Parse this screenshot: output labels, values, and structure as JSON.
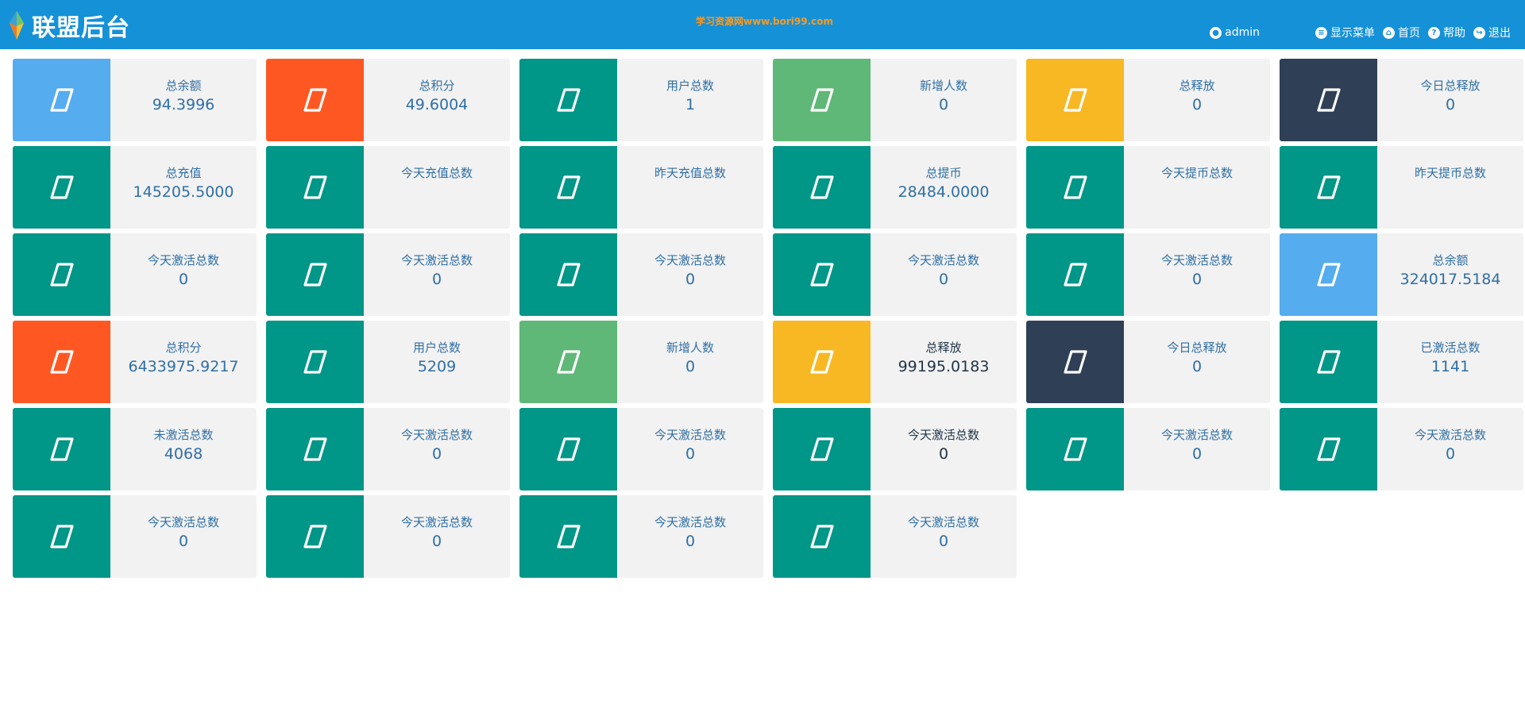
{
  "header": {
    "title": "联盟后台",
    "watermark": "学习资源网www.bori99.com",
    "user": "admin",
    "nav": [
      {
        "label": "显示菜单",
        "icon": "list-icon"
      },
      {
        "label": "首页",
        "icon": "home-icon"
      },
      {
        "label": "帮助",
        "icon": "help-icon"
      },
      {
        "label": "退出",
        "icon": "logout-icon"
      }
    ]
  },
  "colors": {
    "header": "#1591d8",
    "blue": "#55acee",
    "orange": "#ff5722",
    "teal": "#009688",
    "green": "#5fb878",
    "yellow": "#f7b824",
    "navy": "#2f4056",
    "card_bg": "#f2f2f2",
    "label_text": "#2f6fa5"
  },
  "cards": [
    {
      "label": "总余额",
      "value": "94.3996",
      "color": "blue"
    },
    {
      "label": "总积分",
      "value": "49.6004",
      "color": "orange"
    },
    {
      "label": "用户总数",
      "value": "1",
      "color": "teal"
    },
    {
      "label": "新增人数",
      "value": "0",
      "color": "green"
    },
    {
      "label": "总释放",
      "value": "0",
      "color": "yellow"
    },
    {
      "label": "今日总释放",
      "value": "0",
      "color": "navy"
    },
    {
      "label": "总充值",
      "value": "145205.5000",
      "color": "teal"
    },
    {
      "label": "今天充值总数",
      "value": "",
      "color": "teal"
    },
    {
      "label": "昨天充值总数",
      "value": "",
      "color": "teal"
    },
    {
      "label": "总提币",
      "value": "28484.0000",
      "color": "teal"
    },
    {
      "label": "今天提币总数",
      "value": "",
      "color": "teal"
    },
    {
      "label": "昨天提币总数",
      "value": "",
      "color": "teal"
    },
    {
      "label": "今天激活总数",
      "value": "0",
      "color": "teal"
    },
    {
      "label": "今天激活总数",
      "value": "0",
      "color": "teal"
    },
    {
      "label": "今天激活总数",
      "value": "0",
      "color": "teal"
    },
    {
      "label": "今天激活总数",
      "value": "0",
      "color": "teal"
    },
    {
      "label": "今天激活总数",
      "value": "0",
      "color": "teal"
    },
    {
      "label": "总余额",
      "value": "324017.5184",
      "color": "blue"
    },
    {
      "label": "总积分",
      "value": "6433975.9217",
      "color": "orange"
    },
    {
      "label": "用户总数",
      "value": "5209",
      "color": "teal"
    },
    {
      "label": "新增人数",
      "value": "0",
      "color": "green"
    },
    {
      "label": "总释放",
      "value": "99195.0183",
      "color": "yellow",
      "dark": true
    },
    {
      "label": "今日总释放",
      "value": "0",
      "color": "navy"
    },
    {
      "label": "已激活总数",
      "value": "1141",
      "color": "teal"
    },
    {
      "label": "未激活总数",
      "value": "4068",
      "color": "teal"
    },
    {
      "label": "今天激活总数",
      "value": "0",
      "color": "teal"
    },
    {
      "label": "今天激活总数",
      "value": "0",
      "color": "teal"
    },
    {
      "label": "今天激活总数",
      "value": "0",
      "color": "teal",
      "dark": true
    },
    {
      "label": "今天激活总数",
      "value": "0",
      "color": "teal"
    },
    {
      "label": "今天激活总数",
      "value": "0",
      "color": "teal"
    },
    {
      "label": "今天激活总数",
      "value": "0",
      "color": "teal"
    },
    {
      "label": "今天激活总数",
      "value": "0",
      "color": "teal"
    },
    {
      "label": "今天激活总数",
      "value": "0",
      "color": "teal"
    },
    {
      "label": "今天激活总数",
      "value": "0",
      "color": "teal"
    }
  ]
}
